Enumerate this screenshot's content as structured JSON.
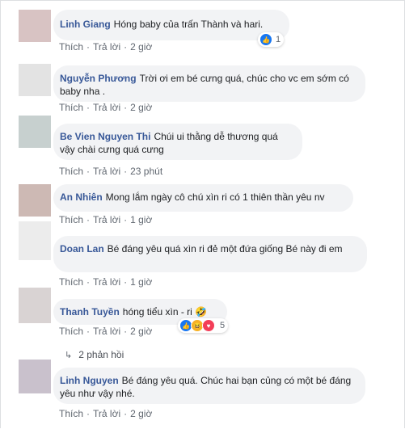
{
  "comments": [
    {
      "author": "Linh Giang",
      "text": "Hóng baby của trấn Thành và hari.",
      "action_like": "Thích",
      "action_reply": "Trả lời",
      "time": "2 giờ",
      "reaction_count": "1",
      "avatar_color": "#d8c3c3"
    },
    {
      "author": "Nguyễn Phương",
      "text": "Trời ơi em bé cưng quá, chúc cho vc em sớm có baby nha .",
      "action_like": "Thích",
      "action_reply": "Trả lời",
      "time": "2 giờ",
      "avatar_color": "#e3e3e3"
    },
    {
      "author": "Be Vien Nguyen Thi",
      "text": "Chúi ui thằng dễ thương quá vậy chài cưng quá cưng",
      "action_like": "Thích",
      "action_reply": "Trả lời",
      "time": "23 phút",
      "avatar_color": "#c7d0cf"
    },
    {
      "author": "An Nhiên",
      "text": "Mong lắm ngày cô chú xìn ri có 1 thiên thần yêu nv",
      "action_like": "Thích",
      "action_reply": "Trả lời",
      "time": "1 giờ",
      "avatar_color": "#cdb9b4"
    },
    {
      "author": "Doan Lan",
      "text": "Bé đáng yêu quá xìn ri đẻ một đứa giống Bé này đi em",
      "action_like": "Thích",
      "action_reply": "Trả lời",
      "time": "1 giờ",
      "avatar_color": "#ececec"
    },
    {
      "author": "Thanh Tuyền",
      "text": "hóng tiểu xìn - ri 🤣",
      "action_like": "Thích",
      "action_reply": "Trả lời",
      "time": "2 giờ",
      "reaction_count": "5",
      "avatar_color": "#d9d3d3"
    },
    {
      "author": "Linh Nguyen",
      "text": "Bé đáng yêu quá. Chúc hai bạn củng có một bé đáng yêu như vậy nhé.",
      "action_like": "Thích",
      "action_reply": "Trả lời",
      "time": "2 giờ",
      "avatar_color": "#c9c1cc"
    }
  ],
  "replies_link": "2 phản hồi"
}
